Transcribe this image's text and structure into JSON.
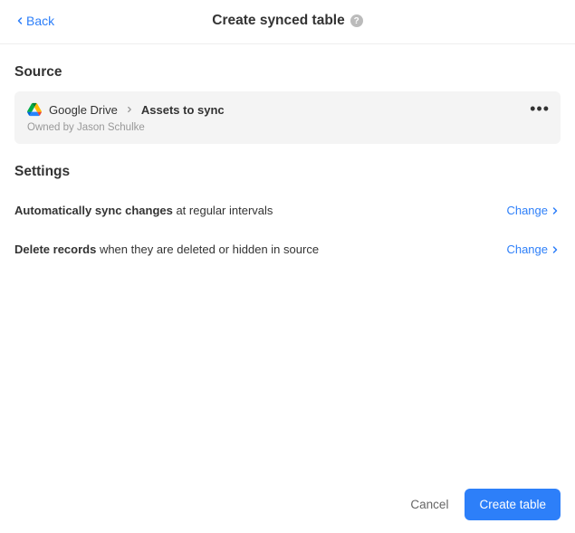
{
  "header": {
    "back_label": "Back",
    "title": "Create synced table",
    "help_glyph": "?"
  },
  "source": {
    "heading": "Source",
    "service": "Google Drive",
    "folder": "Assets to sync",
    "owner": "Owned by Jason Schulke"
  },
  "settings": {
    "heading": "Settings",
    "sync": {
      "bold": "Automatically sync changes",
      "rest": " at regular intervals",
      "action": "Change"
    },
    "delete": {
      "bold": "Delete records",
      "rest": " when they are deleted or hidden in source",
      "action": "Change"
    }
  },
  "footer": {
    "cancel": "Cancel",
    "create": "Create table"
  }
}
